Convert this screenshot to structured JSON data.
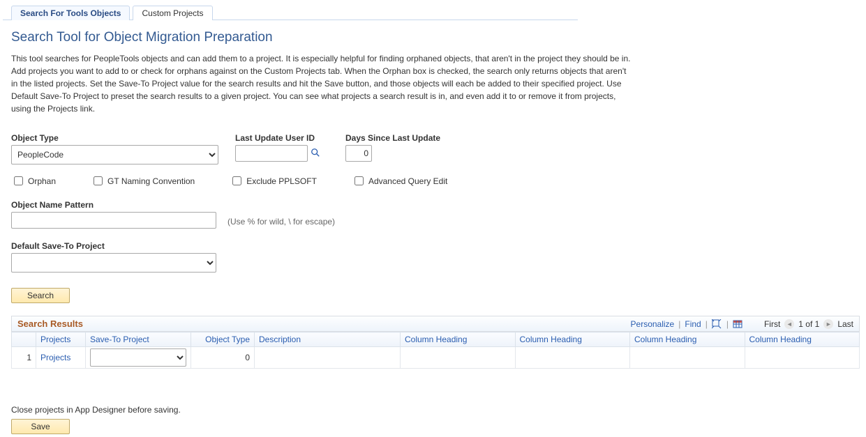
{
  "tabs": {
    "active": "Search For Tools Objects",
    "other": "Custom Projects"
  },
  "title": "Search Tool for Object Migration Preparation",
  "description": "This tool searches for PeopleTools objects and can add them to a project. It is especially helpful for finding orphaned objects, that aren't in the project they should be in. Add projects you want to add to or check for orphans against on the Custom Projects tab. When the Orphan box is checked, the search only returns objects that aren't in the listed projects. Set the Save-To Project value for the search results and hit the Save button, and those objects will each be added to their specified project. Use Default Save-To Project to preset the search results to a given project. You can see what projects a search result is in, and even add it to or remove it from projects, using the Projects link.",
  "form": {
    "object_type_label": "Object Type",
    "object_type_value": "PeopleCode",
    "last_user_label": "Last Update User ID",
    "last_user_value": "",
    "days_label": "Days Since Last Update",
    "days_value": "0",
    "check_orphan": "Orphan",
    "check_gt": "GT Naming Convention",
    "check_exclude": "Exclude PPLSOFT",
    "check_adv": "Advanced Query Edit",
    "pattern_label": "Object Name Pattern",
    "pattern_value": "",
    "pattern_hint": "(Use % for wild, \\ for escape)",
    "default_proj_label": "Default Save-To Project",
    "default_proj_value": "",
    "search_btn": "Search"
  },
  "grid": {
    "title": "Search Results",
    "personalize": "Personalize",
    "find": "Find",
    "first": "First",
    "pager": "1 of 1",
    "last": "Last",
    "cols": {
      "projects": "Projects",
      "save_to": "Save-To Project",
      "obj_type": "Object Type",
      "desc": "Description",
      "ch1": "Column Heading",
      "ch2": "Column Heading",
      "ch3": "Column Heading",
      "ch4": "Column Heading"
    },
    "rows": [
      {
        "num": "1",
        "projects": "Projects",
        "save_to": "",
        "obj_type": "0",
        "desc": "",
        "c1": "",
        "c2": "",
        "c3": "",
        "c4": ""
      }
    ]
  },
  "footer": {
    "note": "Close projects in App Designer before saving.",
    "save_btn": "Save"
  }
}
